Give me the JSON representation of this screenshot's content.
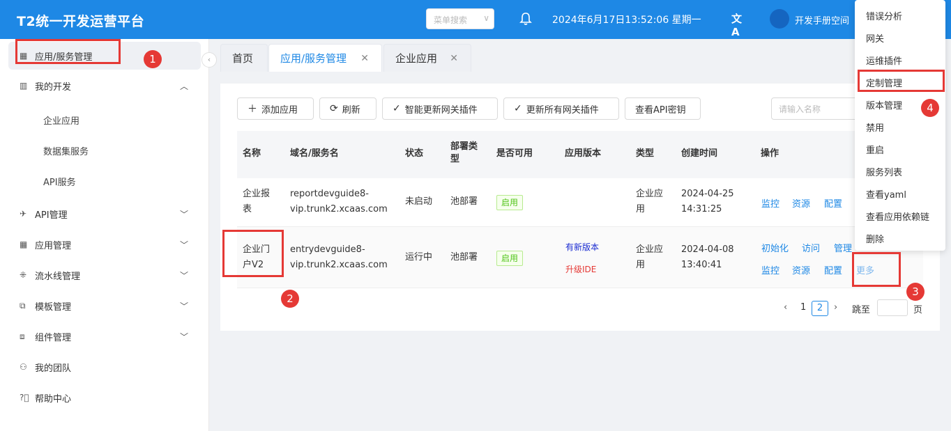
{
  "header": {
    "brand": "T2统一开发运营平台",
    "menu_search_placeholder": "菜单搜索",
    "datetime": "2024年6月17日13:52:06 星期一",
    "translate_glyph": "文A",
    "user_label": "开发手册空间"
  },
  "sidebar": {
    "active_item": "应用/服务管理",
    "items": [
      {
        "label": "我的开发",
        "icon": "code-board-icon",
        "expanded": true
      },
      {
        "label": "API管理",
        "icon": "rocket-icon"
      },
      {
        "label": "应用管理",
        "icon": "grid-icon"
      },
      {
        "label": "流水线管理",
        "icon": "flow-icon"
      },
      {
        "label": "模板管理",
        "icon": "template-icon"
      },
      {
        "label": "组件管理",
        "icon": "component-icon"
      },
      {
        "label": "我的团队",
        "icon": "team-icon"
      },
      {
        "label": "帮助中心",
        "icon": "help-icon"
      }
    ],
    "sub_items": [
      "企业应用",
      "数据集服务",
      "API服务"
    ]
  },
  "tabs": [
    {
      "label": "首页",
      "closable": false
    },
    {
      "label": "应用/服务管理",
      "closable": true,
      "active": true
    },
    {
      "label": "企业应用",
      "closable": true
    }
  ],
  "toolbar": {
    "add_app": "添加应用",
    "refresh": "刷新",
    "smart_update": "智能更新网关插件",
    "update_all": "更新所有网关插件",
    "view_api_key": "查看API密钥",
    "name_placeholder": "请输入名称"
  },
  "table": {
    "columns": [
      "名称",
      "域名/服务名",
      "状态",
      "部署类型",
      "是否可用",
      "应用版本",
      "类型",
      "创建时间",
      "操作"
    ],
    "rows": [
      {
        "name": "企业报表",
        "domain": "reportdevguide8-vip.trunk2.xcaas.com",
        "status": "未启动",
        "deploy": "池部署",
        "available": "启用",
        "version": "",
        "type": "企业应用",
        "created": "2024-04-25 14:31:25",
        "actions": [
          "监控",
          "资源",
          "配置"
        ]
      },
      {
        "name": "企业门户V2",
        "domain": "entrydevguide8-vip.trunk2.xcaas.com",
        "status": "运行中",
        "deploy": "池部署",
        "available": "启用",
        "version_new": "有新版本",
        "version_upgrade": "升级IDE",
        "type": "企业应用",
        "created": "2024-04-08 13:40:41",
        "actions_top": [
          "初始化",
          "访问",
          "管理"
        ],
        "actions_bottom": [
          "监控",
          "资源",
          "配置",
          "更多"
        ]
      }
    ]
  },
  "pagination": {
    "pages": [
      "1",
      "2"
    ],
    "current": "2",
    "jump_label": "跳至",
    "page_suffix": "页"
  },
  "more_menu": [
    "错误分析",
    "网关",
    "运维插件",
    "定制管理",
    "版本管理",
    "禁用",
    "重启",
    "服务列表",
    "查看yaml",
    "查看应用依赖链",
    "删除"
  ],
  "annotations": [
    "1",
    "2",
    "3",
    "4"
  ],
  "colors": {
    "header": "#1e88e5",
    "annotation": "#e53935",
    "link": "#1e88e5",
    "badge_green": "#52c41a"
  }
}
